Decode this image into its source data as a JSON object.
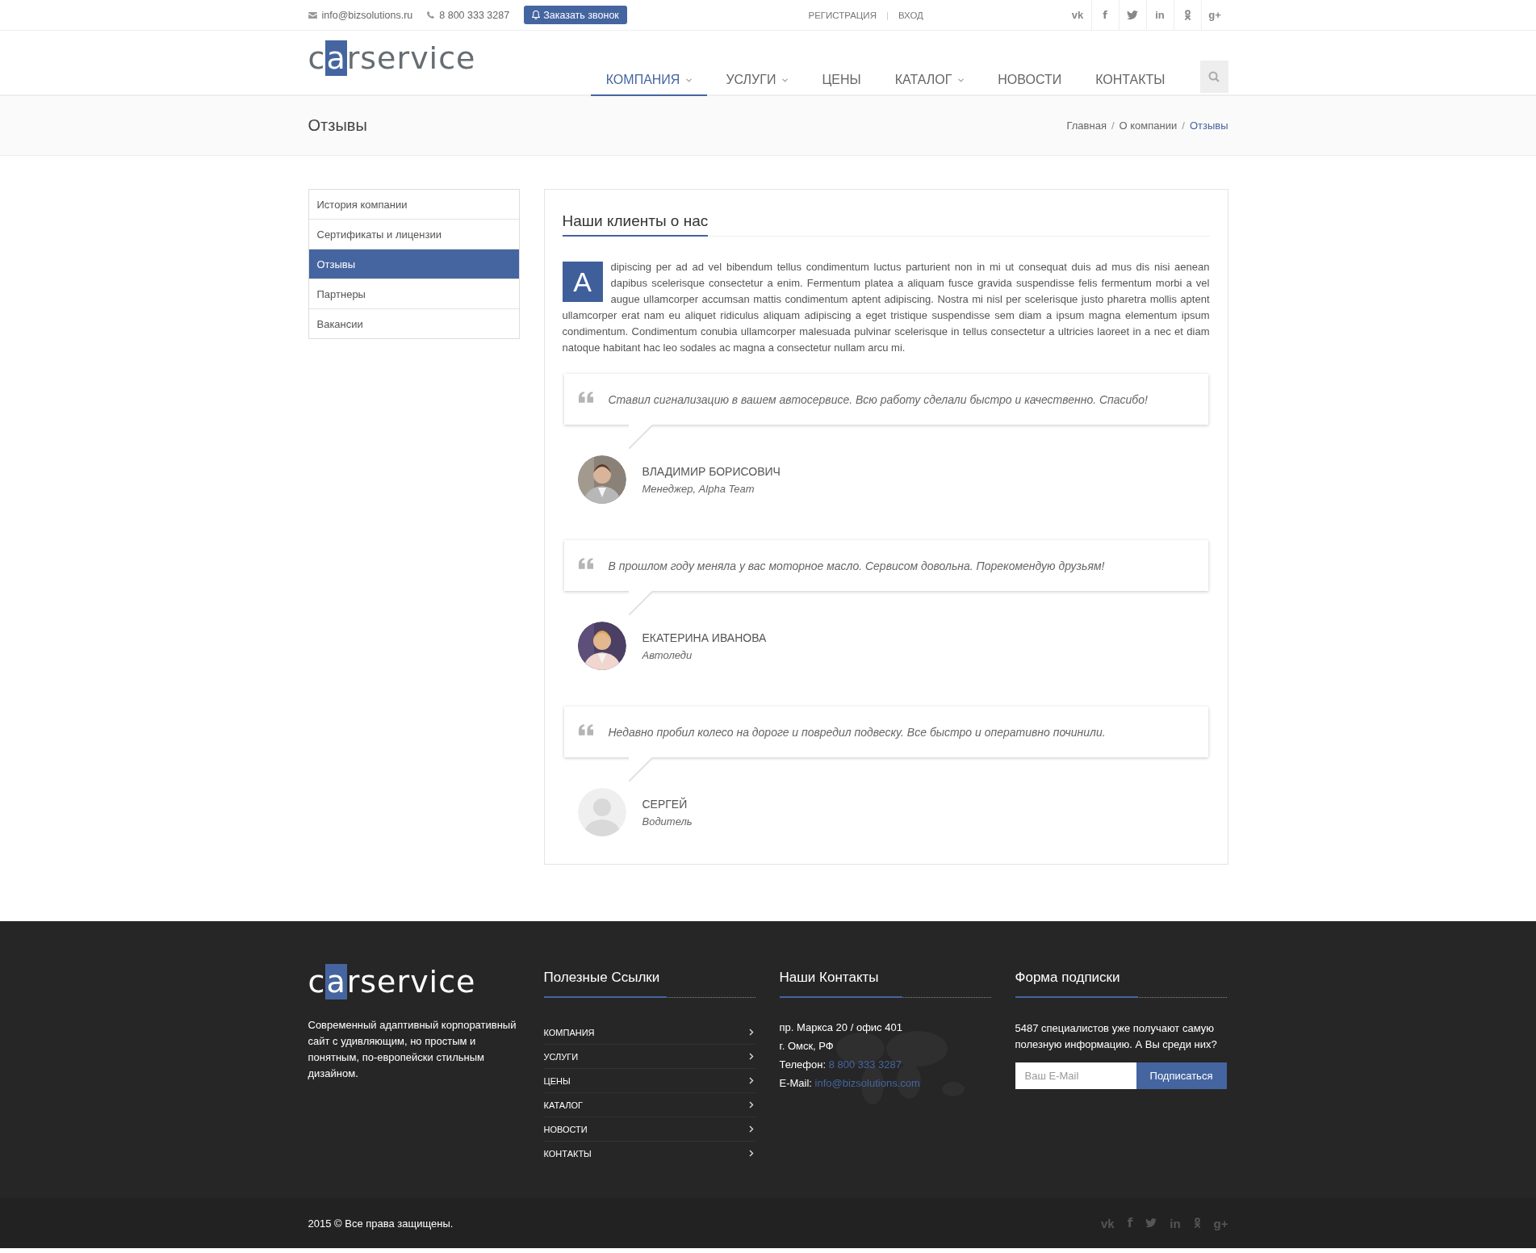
{
  "topbar": {
    "email": "info@bizsolutions.ru",
    "phone": "8 800 333 3287",
    "callback_button": "Заказать звонок",
    "register": "РЕГИСТРАЦИЯ",
    "separator": "|",
    "login": "ВХОД",
    "social": [
      {
        "kind": "vk",
        "glyph": "vk"
      },
      {
        "kind": "facebook",
        "glyph": "f"
      },
      {
        "kind": "twitter"
      },
      {
        "kind": "linkedin",
        "glyph": "in"
      },
      {
        "kind": "odnoklassniki"
      },
      {
        "kind": "googleplus",
        "glyph": "g+"
      }
    ]
  },
  "logo": {
    "before": "c",
    "mark": "a",
    "after": "rservice"
  },
  "nav": [
    {
      "label": "КОМПАНИЯ",
      "dropdown": true,
      "selected": true
    },
    {
      "label": "УСЛУГИ",
      "dropdown": true,
      "selected": false
    },
    {
      "label": "ЦЕНЫ",
      "dropdown": false,
      "selected": false
    },
    {
      "label": "КАТАЛОГ",
      "dropdown": true,
      "selected": false
    },
    {
      "label": "НОВОСТИ",
      "dropdown": false,
      "selected": false
    },
    {
      "label": "КОНТАКТЫ",
      "dropdown": false,
      "selected": false
    }
  ],
  "page_title": "Отзывы",
  "breadcrumbs": {
    "separator": "/",
    "items": [
      {
        "label": "Главная",
        "selected": false
      },
      {
        "label": "О компании",
        "selected": false
      },
      {
        "label": "Отзывы",
        "selected": true
      }
    ]
  },
  "sidebar": {
    "items": [
      {
        "label": "История компании",
        "selected": false
      },
      {
        "label": "Сертификаты и лицензии",
        "selected": false
      },
      {
        "label": "Отзывы",
        "selected": true
      },
      {
        "label": "Партнеры",
        "selected": false
      },
      {
        "label": "Вакансии",
        "selected": false
      }
    ]
  },
  "content": {
    "heading": "Наши клиенты о нас",
    "dropcap": "A",
    "paragraph": "dipiscing per ad ad vel bibendum tellus condimentum luctus parturient non in mi ut consequat duis ad mus dis nisi aenean dapibus scelerisque consectetur a enim. Fermentum platea a aliquam fusce gravida suspendisse felis fermentum morbi a vel augue ullamcorper accumsan mattis condimentum aptent adipiscing. Nostra mi nisl per scelerisque justo pharetra mollis aptent ullamcorper erat nam eu aliquet ridiculus aliquam adipiscing a eget tristique suspendisse sem diam a ipsum magna elementum ipsum condimentum. Condimentum conubia ullamcorper malesuada pulvinar scelerisque in tellus consectetur a ultricies laoreet in a nec et diam natoque habitant hac leo sodales ac magna a consectetur nullam arcu mi.",
    "testimonials": [
      {
        "quote": "Ставил сигнализацию в вашем автосервисе. Всю работу сделали быстро и качественно. Спасибо!",
        "name": "ВЛАДИМИР БОРИСОВИЧ",
        "role": "Менеджер, Alpha Team"
      },
      {
        "quote": "В прошлом году меняла у вас моторное масло. Сервисом довольна. Порекомендую друзьям!",
        "name": "ЕКАТЕРИНА ИВАНОВА",
        "role": "Автоледи"
      },
      {
        "quote": "Недавно пробил колесо на дороге и повредил подвеску. Все быстро и оперативно починили.",
        "name": "СЕРГЕЙ",
        "role": "Водитель",
        "kind": "placeholder"
      }
    ]
  },
  "footer": {
    "logo": {
      "before": "c",
      "mark": "a",
      "after": "rservice"
    },
    "about": "Современный адаптивный корпоративный сайт с удивляющим, но простым и понятным, по-европейски стильным дизайном.",
    "links_title": "Полезные Ссылки",
    "links": [
      "КОМПАНИЯ",
      "УСЛУГИ",
      "ЦЕНЫ",
      "КАТАЛОГ",
      "НОВОСТИ",
      "КОНТАКТЫ"
    ],
    "contacts_title": "Наши Контакты",
    "address_1": "пр. Маркса 20 / офис 401",
    "address_2": "г. Омск, РФ",
    "phone_label": "Телефон:",
    "phone": "8 800 333 3287",
    "email_label": "E-Mail:",
    "email": "info@bizsolutions.com",
    "subscribe_title": "Форма подписки",
    "subscribe_text": "5487 специалистов уже получают самую полезную информацию. А Вы среди них?",
    "email_placeholder": "Ваш E-Mail",
    "subscribe_button": "Подписаться",
    "copyright": "2015 © Все права защищены.",
    "social": [
      {
        "kind": "vk",
        "glyph": "vk"
      },
      {
        "kind": "facebook",
        "glyph": "f"
      },
      {
        "kind": "twitter"
      },
      {
        "kind": "linkedin",
        "glyph": "in"
      },
      {
        "kind": "odnoklassniki"
      },
      {
        "kind": "googleplus",
        "glyph": "g+"
      }
    ]
  }
}
